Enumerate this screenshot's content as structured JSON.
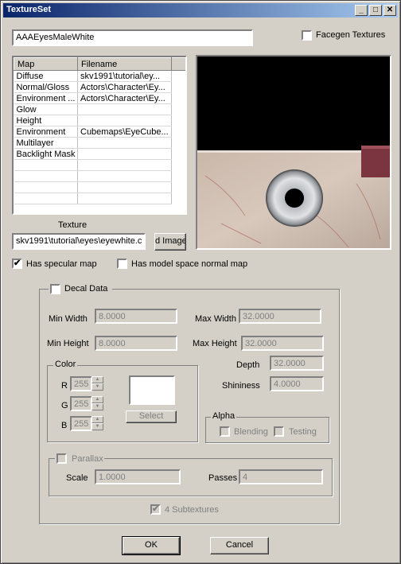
{
  "window": {
    "title": "TextureSet",
    "minimize": "_",
    "maximize": "□",
    "close": "✕"
  },
  "name_value": "AAAEyesMaleWhite",
  "facegen_label": "Facegen Textures",
  "maps": {
    "headers": {
      "map": "Map",
      "filename": "Filename"
    },
    "rows": [
      {
        "map": "Diffuse",
        "file": "skv1991\\tutorial\\ey..."
      },
      {
        "map": "Normal/Gloss",
        "file": "Actors\\Character\\Ey..."
      },
      {
        "map": "Environment ...",
        "file": "Actors\\Character\\Ey..."
      },
      {
        "map": "Glow",
        "file": ""
      },
      {
        "map": "Height",
        "file": ""
      },
      {
        "map": "Environment",
        "file": "Cubemaps\\EyeCube..."
      },
      {
        "map": "Multilayer",
        "file": ""
      },
      {
        "map": "Backlight Mask",
        "file": ""
      },
      {
        "map": "",
        "file": ""
      },
      {
        "map": "",
        "file": ""
      },
      {
        "map": "",
        "file": ""
      },
      {
        "map": "",
        "file": ""
      }
    ]
  },
  "texture": {
    "label": "Texture",
    "path": "skv1991\\tutorial\\eyes\\eyewhite.c",
    "button": "d Image"
  },
  "specular": {
    "label": "Has specular map",
    "checked": "✔"
  },
  "modelspace": {
    "label": "Has model space normal map"
  },
  "decal": {
    "title": "Decal Data",
    "min_width_label": "Min Width",
    "min_width": "8.0000",
    "max_width_label": "Max Width",
    "max_width": "32.0000",
    "min_height_label": "Min Height",
    "min_height": "8.0000",
    "max_height_label": "Max Height",
    "max_height": "32.0000",
    "depth_label": "Depth",
    "depth": "32.0000",
    "shininess_label": "Shininess",
    "shininess": "4.0000",
    "color": {
      "title": "Color",
      "r_label": "R",
      "r": "255",
      "g_label": "G",
      "g": "255",
      "b_label": "B",
      "b": "255",
      "select": "Select"
    },
    "alpha": {
      "title": "Alpha",
      "blending": "Blending",
      "testing": "Testing"
    },
    "parallax": {
      "title": "Parallax",
      "scale_label": "Scale",
      "scale": "1.0000",
      "passes_label": "Passes",
      "passes": "4"
    },
    "subtextures": {
      "label": "4 Subtextures",
      "checked": "✔"
    }
  },
  "buttons": {
    "ok": "OK",
    "cancel": "Cancel"
  }
}
